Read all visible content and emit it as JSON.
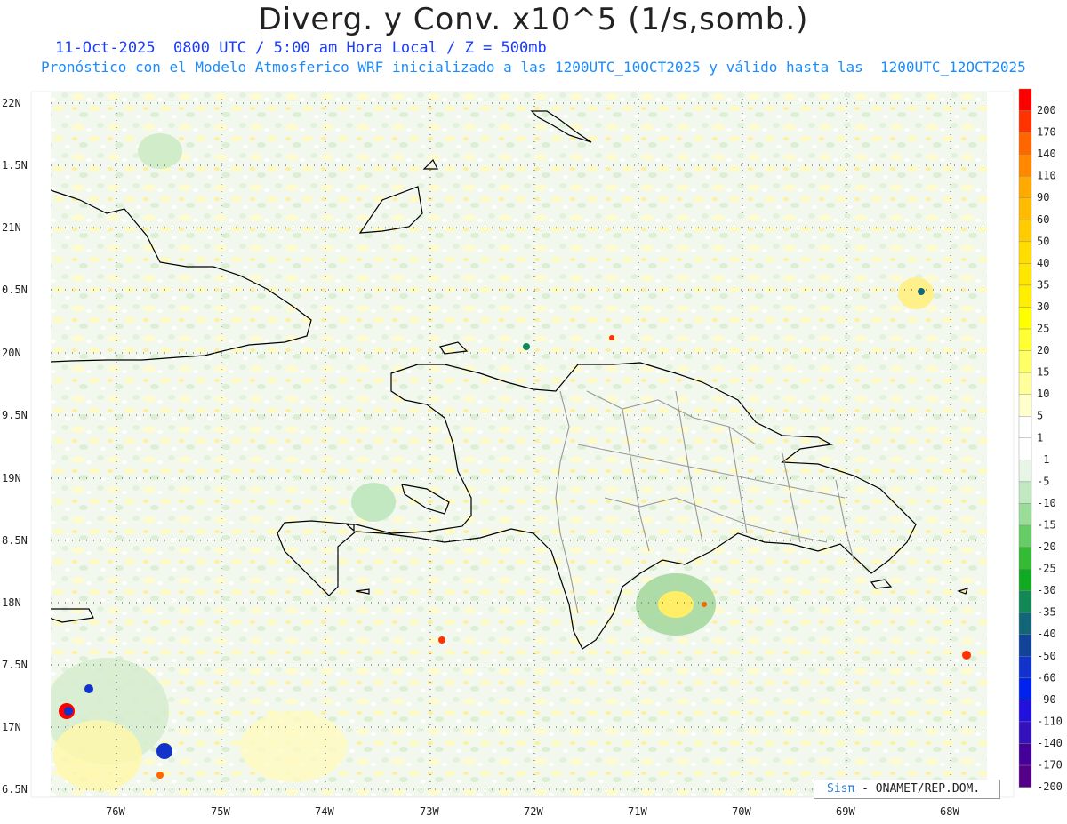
{
  "header": {
    "title": "Diverg. y Conv. x10^5 (1/s,somb.)",
    "subtitle_line1": "11-Oct-2025  0800 UTC / 5:00 am Hora Local / Z = 500mb",
    "subtitle_line2": "Pronóstico con el Modelo Atmosferico WRF inicializado a las 1200UTC_10OCT2025 y válido hasta las  1200UTC_12OCT2025"
  },
  "axes": {
    "lat_labels": [
      "22N",
      "1.5N",
      "21N",
      "0.5N",
      "20N",
      "9.5N",
      "19N",
      "8.5N",
      "18N",
      "7.5N",
      "17N",
      "6.5N"
    ],
    "lon_labels": [
      "76W",
      "75W",
      "74W",
      "73W",
      "72W",
      "71W",
      "70W",
      "69W",
      "68W"
    ]
  },
  "colorbar": {
    "labels": [
      "200",
      "170",
      "140",
      "110",
      "90",
      "60",
      "50",
      "40",
      "35",
      "30",
      "25",
      "20",
      "15",
      "10",
      "5",
      "1",
      "-1",
      "-5",
      "-10",
      "-15",
      "-20",
      "-25",
      "-30",
      "-35",
      "-40",
      "-50",
      "-60",
      "-90",
      "-110",
      "-140",
      "-170",
      "-200"
    ],
    "colors": [
      "#ff0000",
      "#ff3300",
      "#ff6600",
      "#ff8800",
      "#ffaa00",
      "#ffbb00",
      "#ffcc00",
      "#ffdd00",
      "#ffe600",
      "#ffee00",
      "#ffff00",
      "#ffff33",
      "#ffff66",
      "#ffff99",
      "#ffffcc",
      "#ffffff",
      "#ffffff",
      "#e6f5e6",
      "#c2e8c2",
      "#99dd99",
      "#66cc66",
      "#33bb33",
      "#11aa22",
      "#118855",
      "#116677",
      "#114499",
      "#1133cc",
      "#0022ee",
      "#2211dd",
      "#3311bb",
      "#440099",
      "#550088"
    ]
  },
  "credit": {
    "logo": "Sisπ",
    "text": "- ONAMET/REP.DOM."
  },
  "colors": {
    "coast": "#000000",
    "provinces": "#999999",
    "grid": "#555555"
  }
}
